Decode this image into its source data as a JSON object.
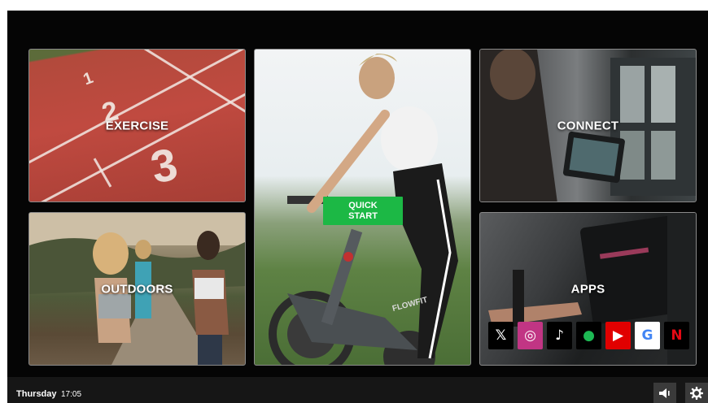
{
  "tiles": {
    "exercise": {
      "label": "EXERCISE"
    },
    "connect": {
      "label": "CONNECT"
    },
    "outdoors": {
      "label": "OUTDOORS"
    },
    "apps": {
      "label": "APPS"
    },
    "quick_start": {
      "line1": "QUICK",
      "line2": "START"
    }
  },
  "track_lane_numbers": [
    "1",
    "2",
    "3"
  ],
  "bike_brand": "FLOWFIT",
  "apps_row": [
    {
      "name": "x-icon",
      "bg": "#000000",
      "glyph": "𝕏",
      "color": "#ffffff"
    },
    {
      "name": "instagram-icon",
      "bg": "#c13584",
      "glyph": "◎",
      "color": "#ffffff"
    },
    {
      "name": "tiktok-icon",
      "bg": "#000000",
      "glyph": "♪",
      "color": "#ffffff"
    },
    {
      "name": "spotify-icon",
      "bg": "#000000",
      "glyph": "●",
      "color": "#1db954"
    },
    {
      "name": "youtube-icon",
      "bg": "#e10000",
      "glyph": "▶",
      "color": "#ffffff"
    },
    {
      "name": "google-icon",
      "bg": "#ffffff",
      "glyph": "G",
      "color": "#4285f4"
    },
    {
      "name": "netflix-icon",
      "bg": "#000000",
      "glyph": "N",
      "color": "#e50914"
    }
  ],
  "status": {
    "day": "Thursday",
    "time": "17:05"
  },
  "colors": {
    "accent_green": "#1cb845",
    "status_bar": "#161616"
  }
}
